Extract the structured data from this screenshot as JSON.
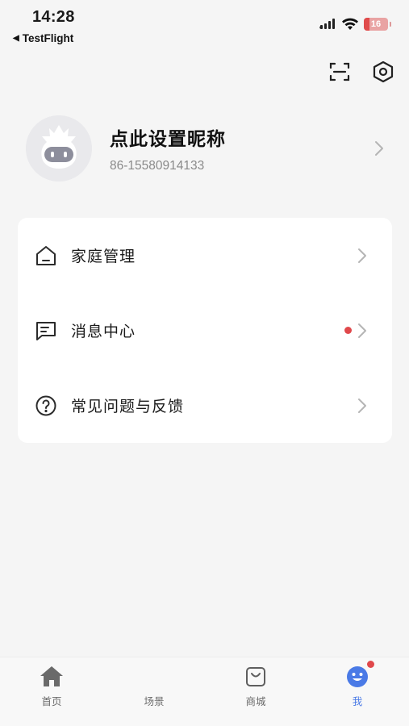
{
  "status_bar": {
    "time": "14:28",
    "back_app": "TestFlight",
    "battery_level": "16"
  },
  "top_actions": {
    "scan_icon": "scan-icon",
    "settings_icon": "hexagon-settings-icon"
  },
  "profile": {
    "nickname": "点此设置昵称",
    "phone": "86-15580914133"
  },
  "menu": {
    "items": [
      {
        "icon": "home-icon",
        "label": "家庭管理",
        "has_dot": false
      },
      {
        "icon": "message-icon",
        "label": "消息中心",
        "has_dot": true
      },
      {
        "icon": "question-icon",
        "label": "常见问题与反馈",
        "has_dot": false
      }
    ]
  },
  "tabbar": {
    "tabs": [
      {
        "icon": "home-filled-icon",
        "label": "首页",
        "active": false
      },
      {
        "icon": "",
        "label": "场景",
        "active": false
      },
      {
        "icon": "shopping-bag-icon",
        "label": "商城",
        "active": false
      },
      {
        "icon": "smiley-user-icon",
        "label": "我",
        "active": true,
        "badge": true
      }
    ]
  },
  "colors": {
    "accent": "#4a7ae6",
    "badge": "#e0484b",
    "background": "#f5f5f5",
    "card": "#ffffff"
  }
}
